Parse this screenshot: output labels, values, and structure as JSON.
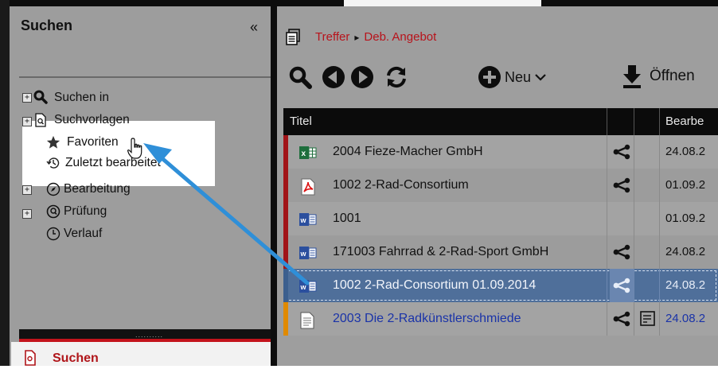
{
  "panel": {
    "title": "Suchen",
    "collapse": "«",
    "footer_label": "Suchen",
    "grip": "..........",
    "tree": [
      {
        "label": "Suchen in",
        "icon": "magnifier-icon",
        "expander": "+"
      },
      {
        "label": "Suchvorlagen",
        "icon": "search-template-icon",
        "expander": "+"
      },
      {
        "label": "Favoriten",
        "icon": "star-icon",
        "expander": ""
      },
      {
        "label": "Zuletzt bearbeitet",
        "icon": "history-icon",
        "expander": ""
      },
      {
        "label": "Bearbeitung",
        "icon": "compass-icon",
        "expander": "+"
      },
      {
        "label": "Prüfung",
        "icon": "check-circle-icon",
        "expander": "+"
      },
      {
        "label": "Verlauf",
        "icon": "clock-icon",
        "expander": ""
      }
    ]
  },
  "breadcrumb": {
    "first": "Treffer",
    "separator": "▸",
    "second": "Deb. Angebot"
  },
  "toolbar": {
    "new_label": "Neu",
    "open_label": "Öffnen"
  },
  "table": {
    "columns": [
      "Titel",
      "",
      "",
      "Bearbe"
    ],
    "rows": [
      {
        "title": "2004  Fieze-Macher GmbH",
        "date": "24.08.2",
        "file_type": "excel-file-icon",
        "marker": "#a11418",
        "bg": "#a3a3a3",
        "shared": true,
        "note": false
      },
      {
        "title": "1002  2-Rad-Consortium",
        "date": "01.09.2",
        "file_type": "pdf-file-icon",
        "marker": "#a11418",
        "bg": "#9c9c9c",
        "shared": true,
        "note": false
      },
      {
        "title": "1001",
        "date": "01.09.2",
        "file_type": "word-file-icon",
        "marker": "#a11418",
        "bg": "#a3a3a3",
        "shared": false,
        "note": false
      },
      {
        "title": "171003  Fahrrad & 2-Rad-Sport GmbH",
        "date": "24.08.2",
        "file_type": "word-file-icon",
        "marker": "#a11418",
        "bg": "#9c9c9c",
        "shared": true,
        "note": false
      },
      {
        "title": "1002  2-Rad-Consortium  01.09.2014",
        "date": "24.08.2",
        "file_type": "word-file-icon",
        "marker": "#3c5f8e",
        "bg": "#4f6f9a",
        "shared": true,
        "note": false,
        "selected": true
      },
      {
        "title": "2003  Die 2-Radkünstlerschmiede",
        "date": "24.08.2",
        "file_type": "text-file-icon",
        "marker": "#e08a00",
        "bg": "#a3a3a3",
        "shared": true,
        "note": true,
        "blue_text": true
      }
    ]
  },
  "colors": {
    "accent_red": "#b8131b",
    "selection": "#4f6f9a",
    "link_blue": "#1a33a8",
    "drag_arrow": "#2f8fd8"
  }
}
